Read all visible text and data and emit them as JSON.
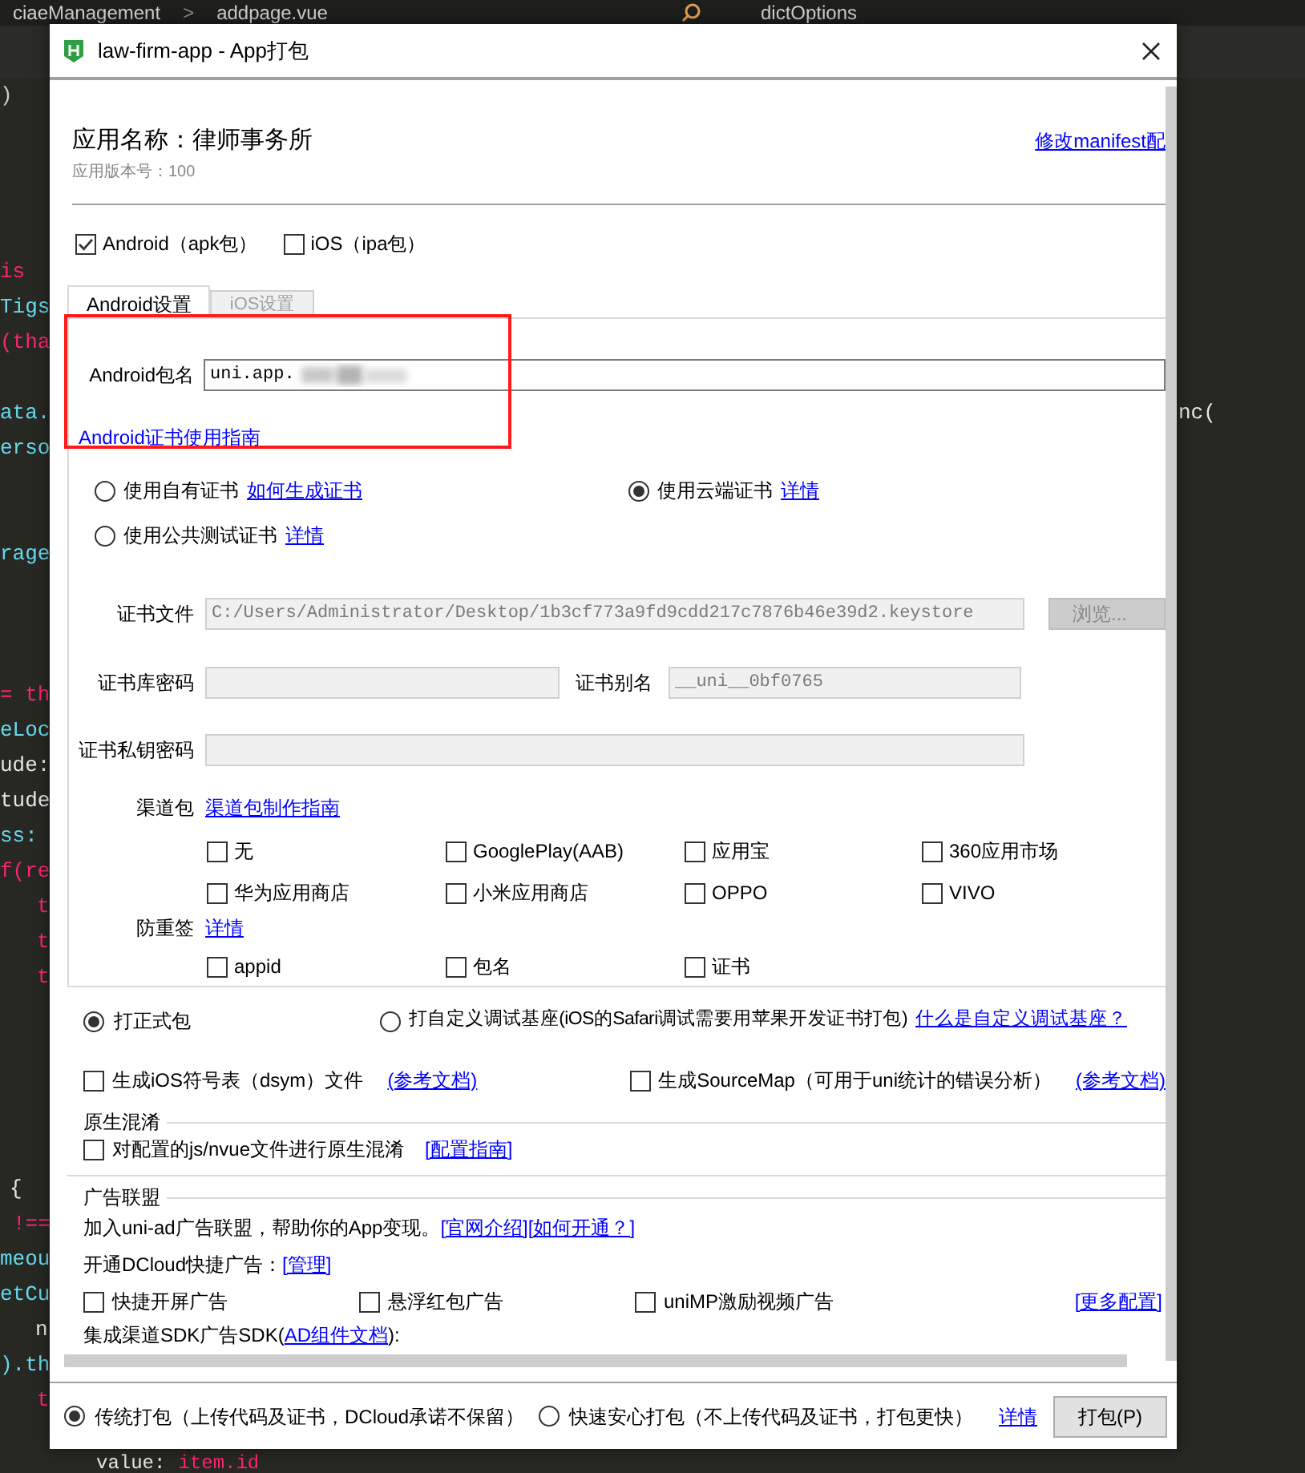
{
  "editor": {
    "breadcrumb": [
      "ciaeManagement",
      ">",
      "addpage.vue"
    ],
    "search": "dictOptions",
    "lines": [
      {
        "tokens": [
          {
            "text": ")",
            "color": "#cccccc"
          }
        ]
      },
      {
        "tokens": [
          {
            "text": "is",
            "color": "#f92672"
          }
        ]
      },
      {
        "tokens": [
          {
            "text": "Tigs",
            "color": "#66d9ef"
          }
        ]
      },
      {
        "tokens": [
          {
            "text": "(tha",
            "color": "#f92672"
          }
        ]
      },
      {
        "tokens": [
          {
            "text": "ata.",
            "color": "#66d9ef"
          }
        ]
      },
      {
        "tokens": [
          {
            "text": "erso",
            "color": "#66d9ef"
          }
        ]
      },
      {
        "tokens": [
          {
            "text": "rage",
            "color": "#66d9ef"
          }
        ]
      },
      {
        "tokens": [
          {
            "text": "= th",
            "color": "#f92672"
          }
        ]
      },
      {
        "tokens": [
          {
            "text": "eLoc",
            "color": "#66d9ef"
          }
        ]
      },
      {
        "tokens": [
          {
            "text": "ude:",
            "color": "#e6e6e6"
          }
        ]
      },
      {
        "tokens": [
          {
            "text": "tude",
            "color": "#e6e6e6"
          }
        ]
      },
      {
        "tokens": [
          {
            "text": "ss:",
            "color": "#66d9ef"
          }
        ]
      },
      {
        "tokens": [
          {
            "text": "f(re",
            "color": "#f92672"
          }
        ]
      },
      {
        "tokens": [
          {
            "text": "t",
            "color": "#f92672"
          }
        ]
      },
      {
        "tokens": [
          {
            "text": "t",
            "color": "#f92672"
          }
        ]
      },
      {
        "tokens": [
          {
            "text": "t",
            "color": "#f92672"
          }
        ]
      },
      {
        "tokens": [
          {
            "text": "{",
            "color": "#e6e6e6"
          }
        ]
      },
      {
        "tokens": [
          {
            "text": "!==",
            "color": "#f92672"
          }
        ]
      },
      {
        "tokens": [
          {
            "text": "meou",
            "color": "#66d9ef"
          }
        ]
      },
      {
        "tokens": [
          {
            "text": "etCu",
            "color": "#66d9ef"
          }
        ]
      },
      {
        "tokens": [
          {
            "text": "n",
            "color": "#e6e6e6"
          }
        ]
      },
      {
        "tokens": [
          {
            "text": ").th",
            "color": "#66d9ef"
          }
        ]
      },
      {
        "tokens": [
          {
            "text": "t",
            "color": "#f92672"
          }
        ]
      },
      {
        "tokens": [
          {
            "text": "value:",
            "color": "#e6e6e6"
          },
          {
            "text": "item.id",
            "color": "#f92672"
          }
        ]
      }
    ],
    "right_lines": [
      {
        "text": "nc(",
        "color": "#e6e6e6"
      }
    ]
  },
  "dialog": {
    "title": "law-firm-app - App打包",
    "app_name": "应用名称：律师事务所",
    "manifest_link": "修改manifest配",
    "app_version": "应用版本号：100",
    "platforms": [
      {
        "label": "Android（apk包）",
        "checked": true
      },
      {
        "label": "iOS（ipa包）",
        "checked": false
      }
    ],
    "tabs": [
      {
        "label": "Android设置",
        "selected": true
      },
      {
        "label": "iOS设置",
        "selected": false
      }
    ],
    "package_name": {
      "label": "Android包名",
      "value": "uni.app."
    },
    "cert_guide_link": "Android证书使用指南",
    "cert_options": [
      {
        "label": "使用自有证书",
        "link": "如何生成证书",
        "selected": false
      },
      {
        "label": "使用云端证书",
        "link": "详情",
        "selected": true
      },
      {
        "label": "使用公共测试证书",
        "link": "详情",
        "selected": false
      }
    ],
    "cert_file": {
      "label": "证书文件",
      "value": "C:/Users/Administrator/Desktop/1b3cf773a9fd9cdd217c7876b46e39d2.keystore",
      "disabled": true,
      "button": "浏览...",
      "button_disabled": true
    },
    "keystore_password": {
      "label": "证书库密码",
      "disabled": true
    },
    "alias": {
      "label": "证书别名",
      "value": "__uni__0bf0765",
      "disabled": true
    },
    "key_password": {
      "label": "证书私钥密码",
      "disabled": true
    },
    "channels": {
      "label": "渠道包",
      "link": "渠道包制作指南",
      "items": [
        {
          "label": "无",
          "checked": false
        },
        {
          "label": "GooglePlay(AAB)",
          "checked": false
        },
        {
          "label": "应用宝",
          "checked": false
        },
        {
          "label": "360应用市场",
          "checked": false
        },
        {
          "label": "华为应用商店",
          "checked": false
        },
        {
          "label": "小米应用商店",
          "checked": false
        },
        {
          "label": "OPPO",
          "checked": false
        },
        {
          "label": "VIVO",
          "checked": false
        }
      ]
    },
    "anti_resign": {
      "label": "防重签",
      "link": "详情",
      "items": [
        {
          "label": "appid",
          "checked": false
        },
        {
          "label": "包名",
          "checked": false
        },
        {
          "label": "证书",
          "checked": false
        }
      ]
    },
    "build_types": [
      {
        "label": "打正式包",
        "selected": true
      },
      {
        "label": "打自定义调试基座(iOS的Safari调试需要用苹果开发证书打包)",
        "selected": false
      }
    ],
    "build_type_link": "什么是自定义调试基座？",
    "extras": [
      {
        "label": "生成iOS符号表（dsym）文件",
        "link": "(参考文档)",
        "checked": false
      },
      {
        "label": "生成SourceMap（可用于uni统计的错误分析）",
        "link": "(参考文档)",
        "checked": false
      }
    ],
    "obfuscation": {
      "title": "原生混淆",
      "label": "对配置的js/nvue文件进行原生混淆",
      "link": "[配置指南]",
      "checked": false
    },
    "ads": {
      "title": "广告联盟",
      "intro": "加入uni-ad广告联盟，帮助你的App变现。",
      "intro_links": [
        "[官网介绍]",
        "[如何开通？]"
      ],
      "dcloud": "开通DCloud快捷广告：",
      "dcloud_link": "[管理]",
      "items": [
        {
          "label": "快捷开屏广告",
          "checked": false
        },
        {
          "label": "悬浮红包广告",
          "checked": false
        },
        {
          "label": "uniMP激励视频广告",
          "checked": false
        }
      ],
      "more_link": "[更多配置]",
      "sdk_prefix": "集成渠道SDK广告SDK(",
      "sdk_link": "AD组件文档",
      "sdk_suffix": "):"
    },
    "footer": {
      "modes": [
        {
          "label": "传统打包（上传代码及证书，DCloud承诺不保留）",
          "selected": true
        },
        {
          "label": "快速安心打包（不上传代码及证书，打包更快）",
          "selected": false
        }
      ],
      "link": "详情",
      "button": "打包(P)"
    }
  }
}
